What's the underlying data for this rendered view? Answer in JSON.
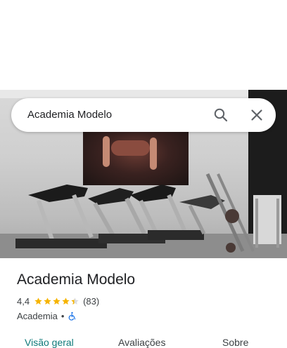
{
  "search": {
    "query": "Academia Modelo"
  },
  "place": {
    "title": "Academia Modelo",
    "rating": "4,4",
    "stars_filled": 4.4,
    "review_count": "(83)",
    "category": "Academia",
    "separator": "•"
  },
  "tabs": [
    {
      "label": "Visão geral"
    },
    {
      "label": "Avaliações"
    },
    {
      "label": "Sobre"
    }
  ],
  "colors": {
    "star": "#f6b400",
    "accessibility_icon": "#1a73e8",
    "active_tab": "#0f7a7a"
  },
  "icons": [
    "search-icon",
    "close-icon",
    "star-icon",
    "wheelchair-icon"
  ]
}
